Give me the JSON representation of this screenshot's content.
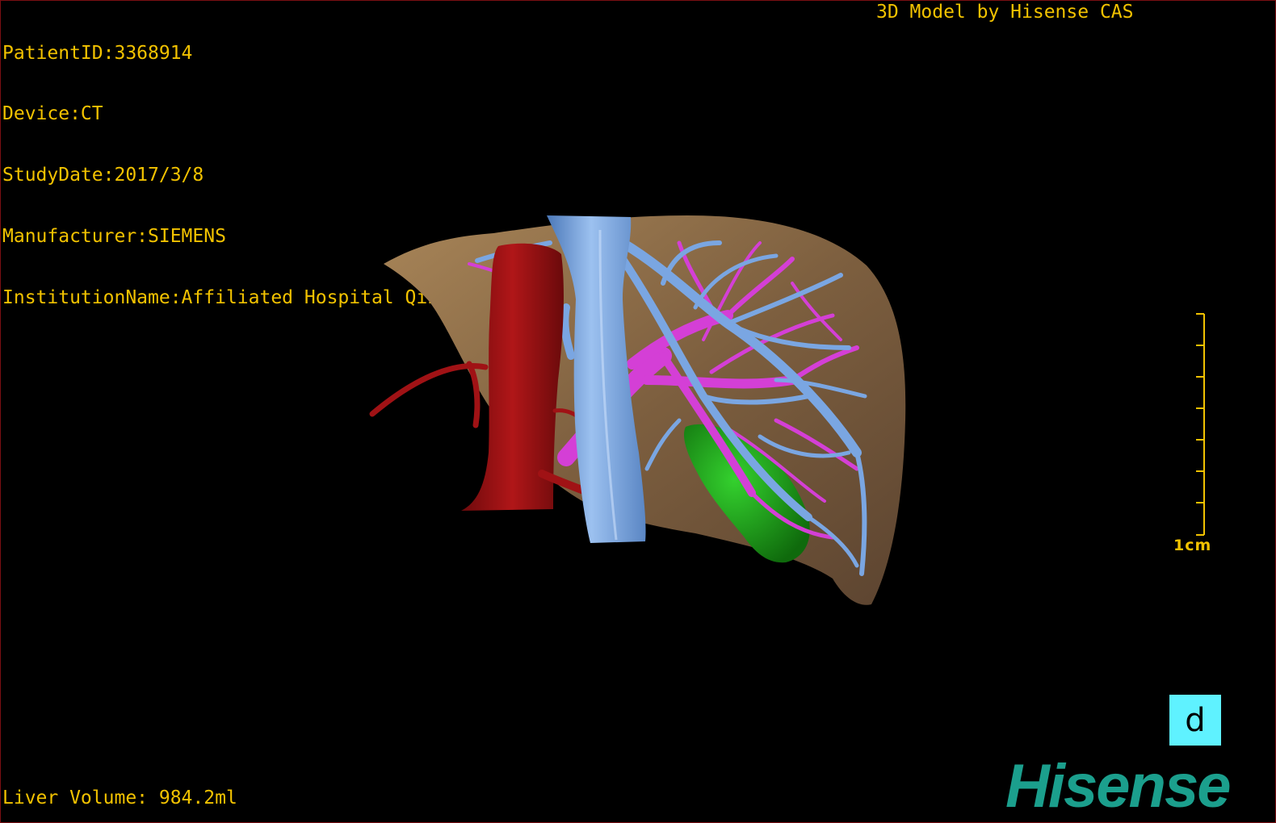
{
  "info": {
    "patient_id": "PatientID:3368914",
    "device": "Device:CT",
    "study_date": "StudyDate:2017/3/8",
    "manufacturer": "Manufacturer:SIEMENS",
    "institution": "InstitutionName:Affiliated Hospital Qingdao University-C"
  },
  "credit": "3D Model by Hisense CAS",
  "scale": {
    "label": "1cm"
  },
  "orientation": {
    "label": "d"
  },
  "brand": "Hisense",
  "measurement": {
    "liver_volume": "Liver Volume: 984.2ml"
  },
  "colors": {
    "text": "#f2c200",
    "liver": "#8a6a45",
    "inferior_vena_cava": "#6f9fde",
    "portal_vein": "#d43fd6",
    "aorta": "#9b1014",
    "gallbladder": "#1ea81a",
    "brand": "#1b9f8d",
    "orientation_cube": "#5ff2ff"
  },
  "icons": {
    "orientation": "orientation-cube-icon",
    "scale": "scale-bar-icon"
  }
}
